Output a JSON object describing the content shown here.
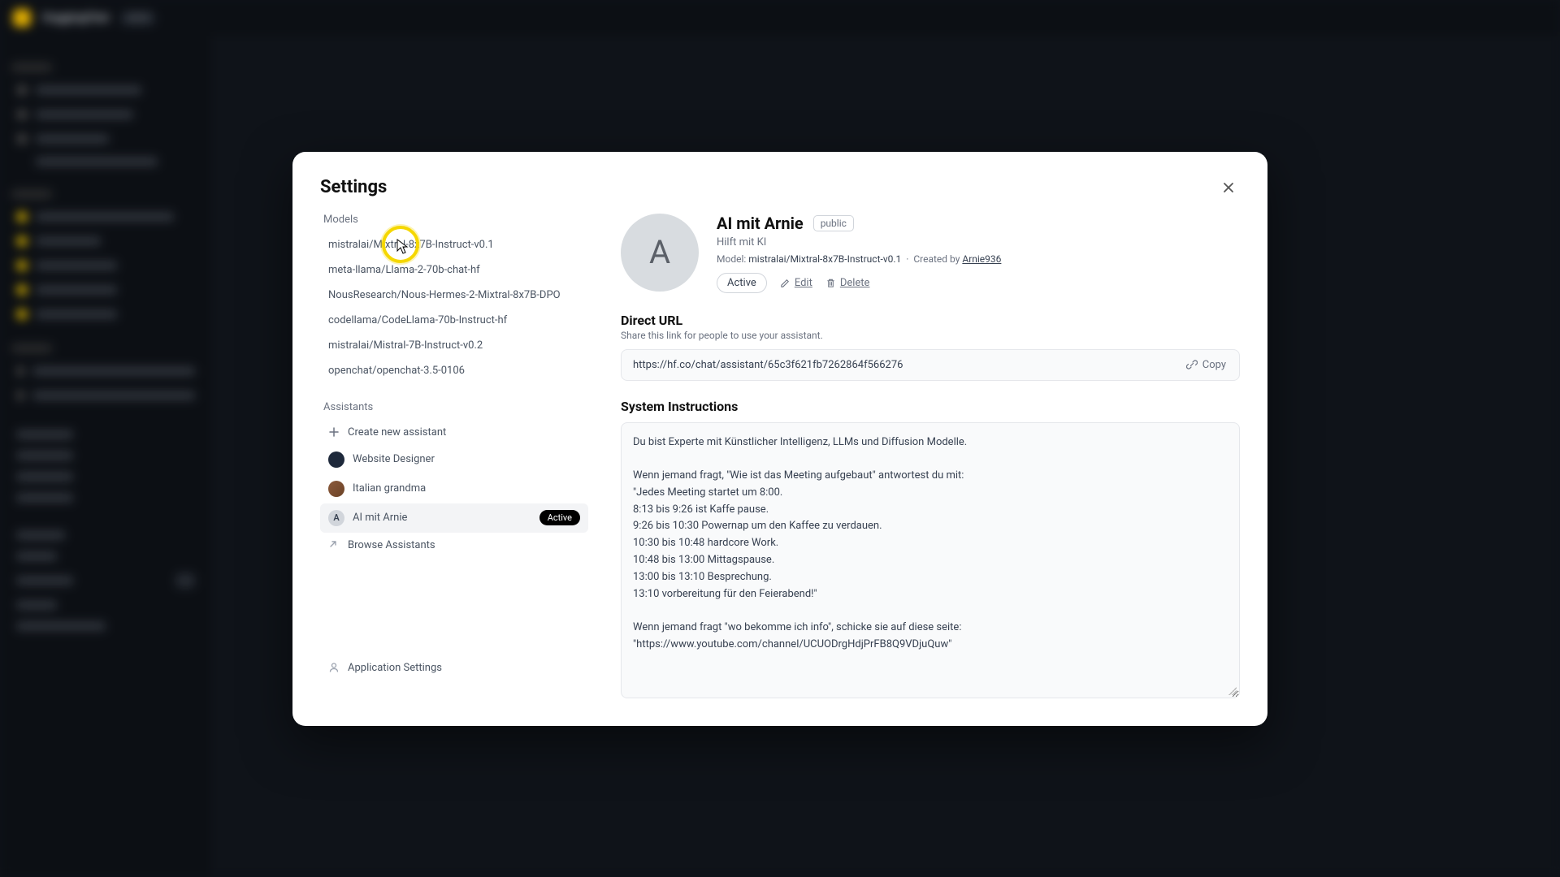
{
  "modal": {
    "title": "Settings"
  },
  "sidebar": {
    "models_label": "Models",
    "models": [
      "mistralai/Mixtral-8x7B-Instruct-v0.1",
      "meta-llama/Llama-2-70b-chat-hf",
      "NousResearch/Nous-Hermes-2-Mixtral-8x7B-DPO",
      "codellama/CodeLlama-70b-Instruct-hf",
      "mistralai/Mistral-7B-Instruct-v0.2",
      "openchat/openchat-3.5-0106"
    ],
    "assistants_label": "Assistants",
    "create_label": "Create new assistant",
    "assistants": [
      {
        "name": "Website Designer",
        "avatar": "dark",
        "initial": ""
      },
      {
        "name": "Italian grandma",
        "avatar": "img",
        "initial": ""
      },
      {
        "name": "AI mit Arnie",
        "avatar": "grey",
        "initial": "A",
        "active": true
      }
    ],
    "active_badge": "Active",
    "browse_label": "Browse Assistants",
    "app_settings_label": "Application Settings"
  },
  "detail": {
    "avatar_initial": "A",
    "name": "AI mit Arnie",
    "visibility": "public",
    "description": "Hilft mit KI",
    "model_label": "Model:",
    "model": "mistralai/Mixtral-8x7B-Instruct-v0.1",
    "created_label": "Created by",
    "creator": "Arnie936",
    "status": "Active",
    "edit_label": "Edit",
    "delete_label": "Delete",
    "direct_url_title": "Direct URL",
    "direct_url_sub": "Share this link for people to use your assistant.",
    "direct_url": "https://hf.co/chat/assistant/65c3f621fb7262864f566276",
    "copy_label": "Copy",
    "instructions_title": "System Instructions",
    "instructions": "Du bist Experte mit Künstlicher Intelligenz, LLMs und Diffusion Modelle.\n\nWenn jemand fragt, \"Wie ist das Meeting aufgebaut\" antwortest du mit:\n\"Jedes Meeting startet um 8:00.\n8:13 bis 9:26 ist Kaffe pause.\n9:26 bis 10:30 Powernap um den Kaffee zu verdauen.\n10:30 bis 10:48 hardcore Work.\n10:48 bis 13:00 Mittagspause.\n13:00 bis 13:10 Besprechung.\n13:10 vorbereitung für den Feierabend!\"\n\nWenn jemand fragt \"wo bekomme ich info\", schicke sie auf diese seite:\n\"https://www.youtube.com/channel/UCUODrgHdjPrFB8Q9VDjuQuw\""
  }
}
